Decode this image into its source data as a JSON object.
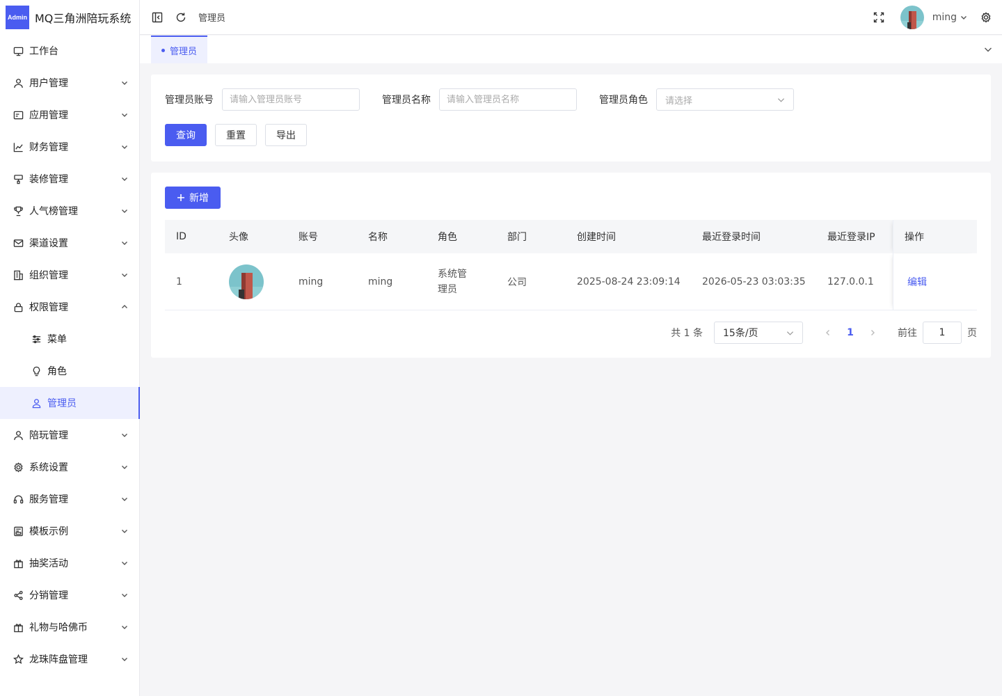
{
  "app": {
    "logo_badge": "Admin",
    "title": "MQ三角洲陪玩系统"
  },
  "colors": {
    "accent": "#4a5cf0"
  },
  "sidebar": {
    "items": [
      {
        "label": "工作台",
        "icon": "monitor-icon",
        "arrow": ""
      },
      {
        "label": "用户管理",
        "icon": "user-icon",
        "arrow": "down"
      },
      {
        "label": "应用管理",
        "icon": "app-icon",
        "arrow": "down"
      },
      {
        "label": "财务管理",
        "icon": "chart-icon",
        "arrow": "down"
      },
      {
        "label": "装修管理",
        "icon": "brush-icon",
        "arrow": "down"
      },
      {
        "label": "人气榜管理",
        "icon": "trophy-icon",
        "arrow": "down"
      },
      {
        "label": "渠道设置",
        "icon": "mail-icon",
        "arrow": "down"
      },
      {
        "label": "组织管理",
        "icon": "building-icon",
        "arrow": "down"
      },
      {
        "label": "权限管理",
        "icon": "lock-icon",
        "arrow": "up"
      }
    ],
    "sub_items": [
      {
        "label": "菜单",
        "icon": "sliders-icon"
      },
      {
        "label": "角色",
        "icon": "bulb-icon"
      },
      {
        "label": "管理员",
        "icon": "admin-user-icon"
      }
    ],
    "items_after": [
      {
        "label": "陪玩管理",
        "icon": "user-icon"
      },
      {
        "label": "系统设置",
        "icon": "gear-icon"
      },
      {
        "label": "服务管理",
        "icon": "headset-icon"
      },
      {
        "label": "模板示例",
        "icon": "template-icon"
      },
      {
        "label": "抽奖活动",
        "icon": "gift-icon"
      },
      {
        "label": "分销管理",
        "icon": "share-icon"
      },
      {
        "label": "礼物与哈佛币",
        "icon": "gift-icon"
      },
      {
        "label": "龙珠阵盘管理",
        "icon": "star-icon"
      }
    ]
  },
  "header": {
    "breadcrumb": "管理员",
    "username": "ming"
  },
  "tabs": [
    {
      "label": "管理员"
    }
  ],
  "filter": {
    "account_label": "管理员账号",
    "account_placeholder": "请输入管理员账号",
    "name_label": "管理员名称",
    "name_placeholder": "请输入管理员名称",
    "role_label": "管理员角色",
    "role_placeholder": "请选择",
    "query_label": "查询",
    "reset_label": "重置",
    "export_label": "导出"
  },
  "table": {
    "add_label": "新增",
    "columns": [
      "ID",
      "头像",
      "账号",
      "名称",
      "角色",
      "部门",
      "创建时间",
      "最近登录时间",
      "最近登录IP",
      "操作"
    ],
    "rows": [
      {
        "id": "1",
        "account": "ming",
        "name": "ming",
        "role": "系统管理员",
        "dept": "公司",
        "created": "2025-08-24 23:09:14",
        "last_login": "2026-05-23 03:03:35",
        "ip": "127.0.0.1",
        "action": "编辑"
      }
    ]
  },
  "pagination": {
    "total": "共 1 条",
    "page_size": "15条/页",
    "current_page": "1",
    "goto_label": "前往",
    "goto_value": "1",
    "page_suffix": "页"
  }
}
